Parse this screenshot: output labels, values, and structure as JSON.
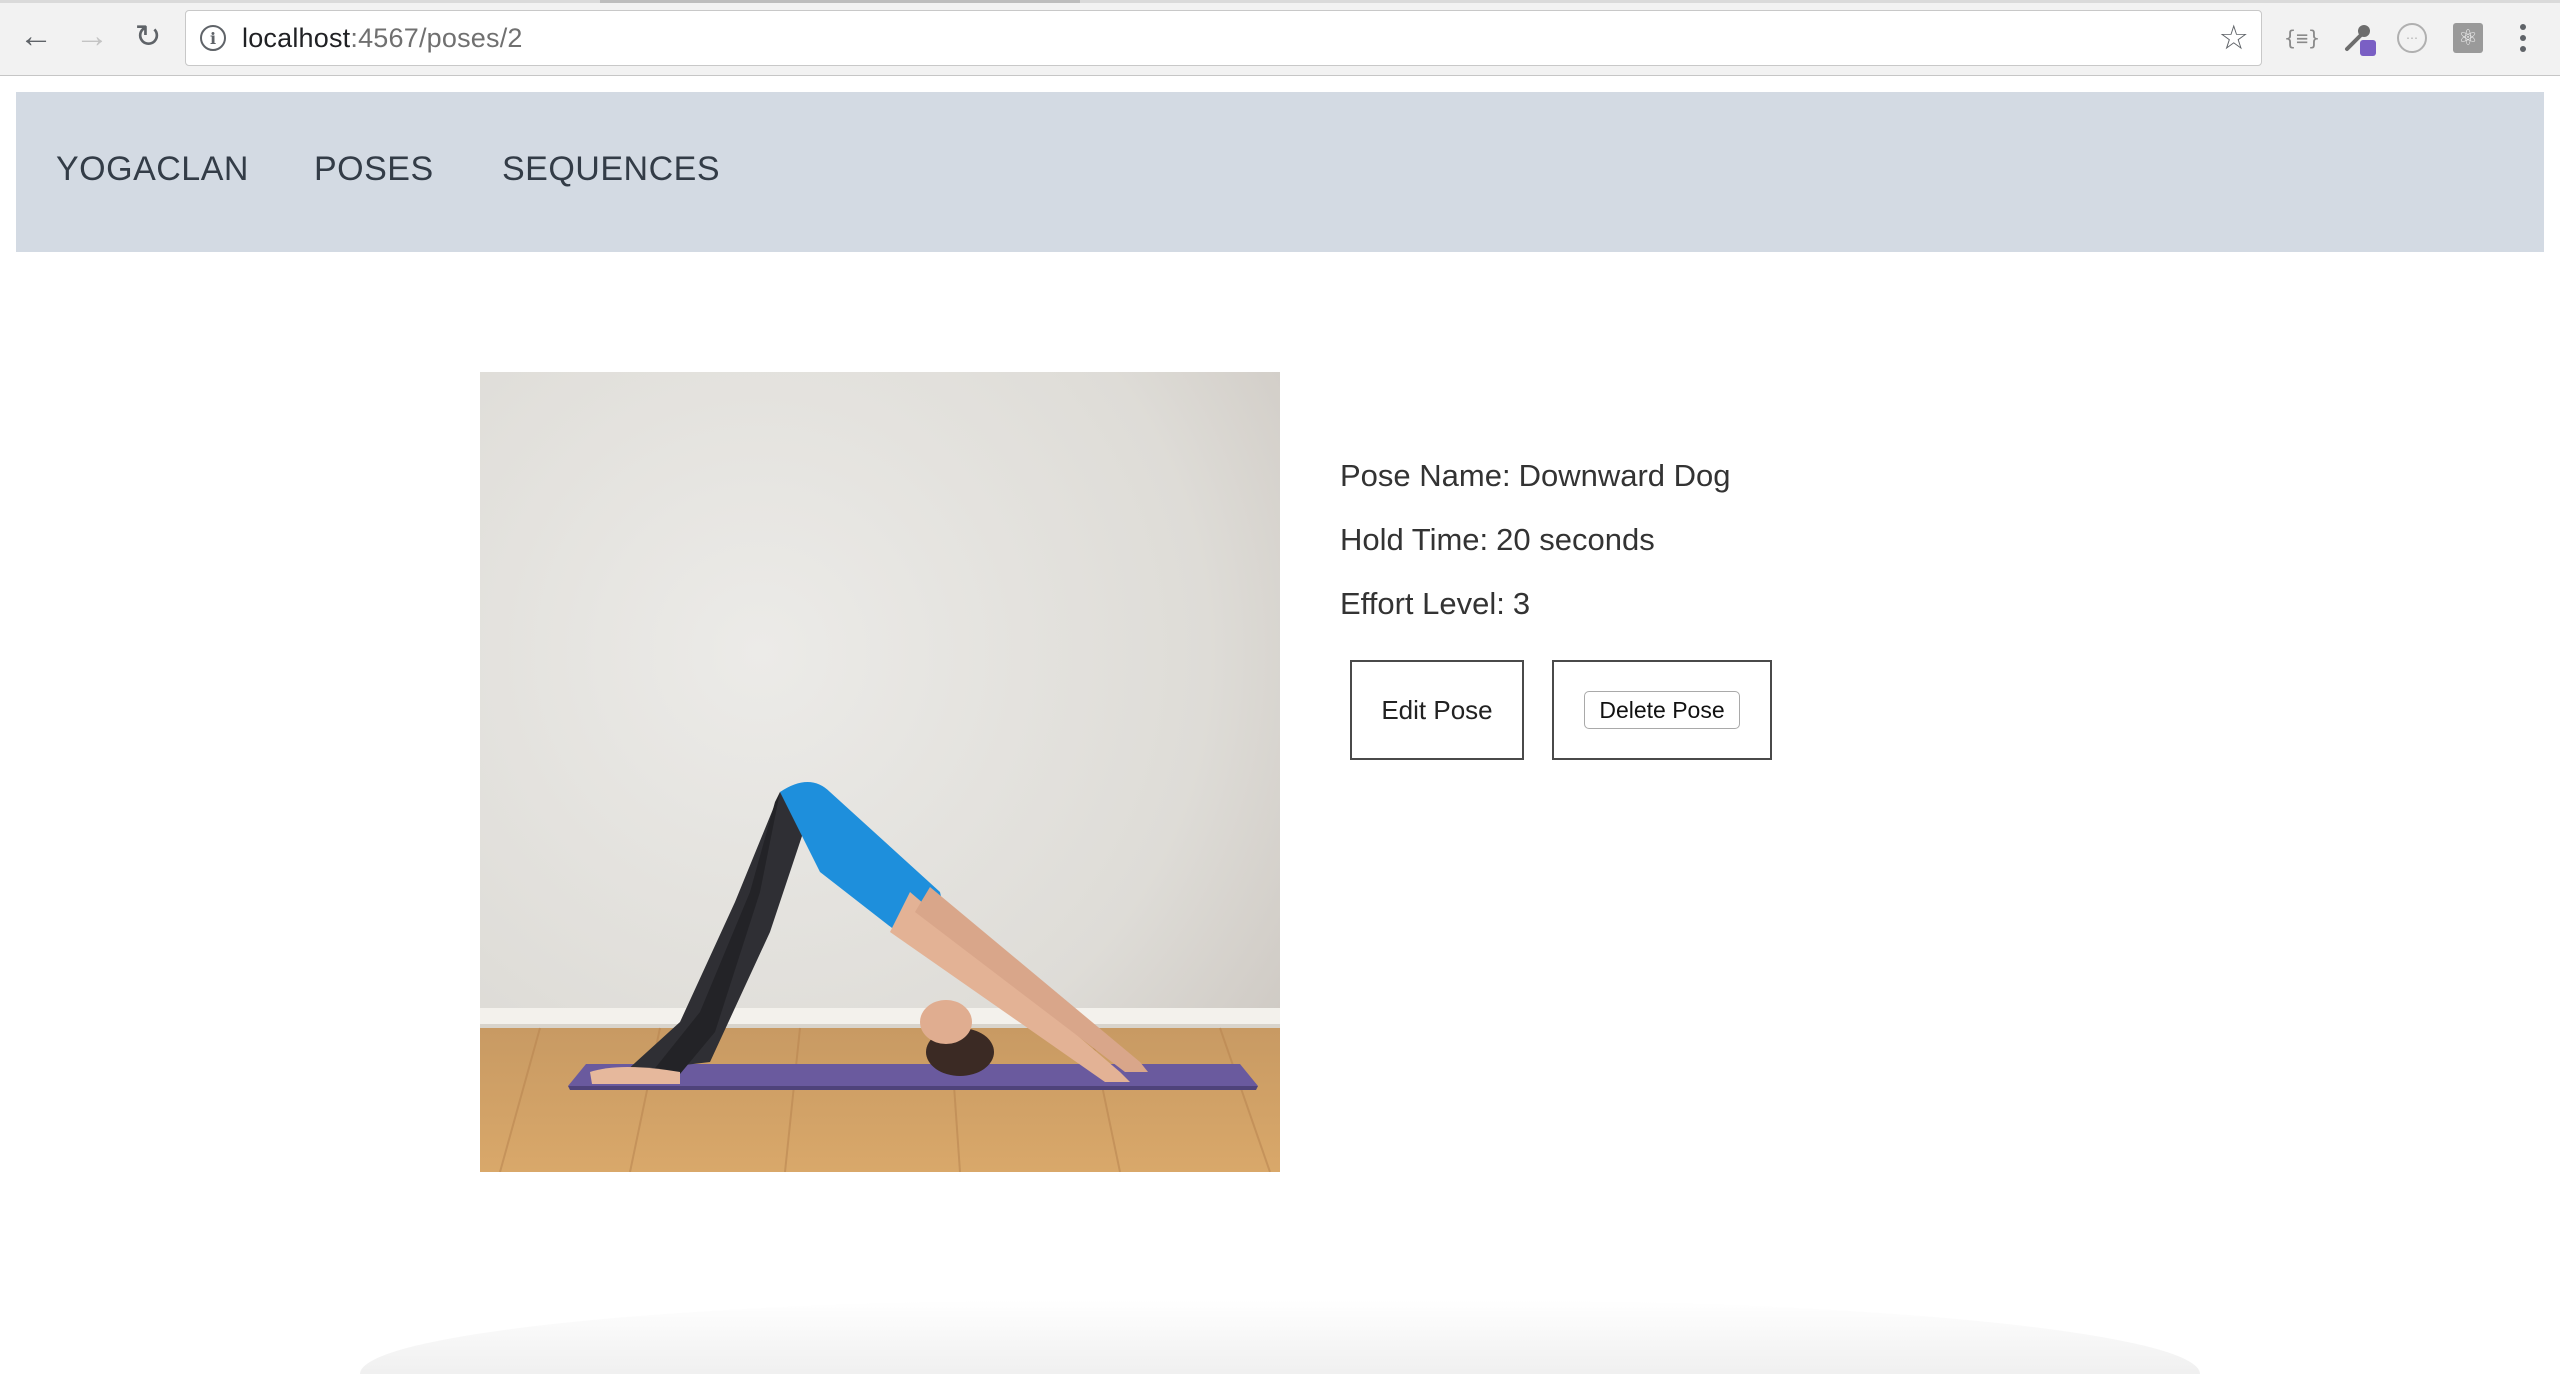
{
  "browser": {
    "url_host": "localhost",
    "url_rest": ":4567/poses/2",
    "icons": {
      "back": "back-arrow-icon",
      "forward": "forward-arrow-icon",
      "reload": "reload-icon",
      "info": "info-icon",
      "bookmark": "star-icon",
      "json_ext": "json-viewer-icon",
      "tool_ext": "eyedropper-icon",
      "circle_ext": "ext-circle-icon",
      "react_ext": "react-devtools-icon",
      "menu": "more-vertical-icon"
    },
    "json_ext_glyph": "{≡}"
  },
  "nav": {
    "brand": "YOGACLAN",
    "links": [
      {
        "label": "POSES"
      },
      {
        "label": "SEQUENCES"
      }
    ],
    "background": "#d3dae3"
  },
  "pose": {
    "name_label": "Pose Name:",
    "name": "Downward Dog",
    "hold_label": "Hold Time:",
    "hold_time": "20 seconds",
    "effort_label": "Effort Level:",
    "effort_level": "3",
    "image_subject": "woman-in-downward-dog-on-purple-mat"
  },
  "actions": {
    "edit_label": "Edit Pose",
    "delete_label": "Delete Pose"
  }
}
